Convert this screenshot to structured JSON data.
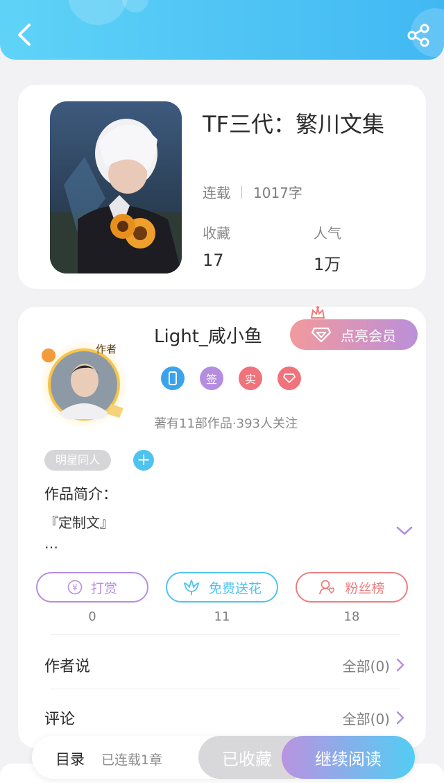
{
  "header": {
    "back_icon": "chevron-left-icon",
    "share_icon": "share-icon",
    "color": "#41b8f3"
  },
  "book": {
    "title": "TF三代：繁川文集",
    "status": "连载",
    "word_count": "1017字",
    "stats": [
      {
        "label": "收藏",
        "value": "17"
      },
      {
        "label": "人气",
        "value": "1万"
      }
    ]
  },
  "author": {
    "name": "Light_咸小鱼",
    "avatar_badge": "作者",
    "vip_button": "点亮会员",
    "badges": [
      {
        "icon": "phone-icon",
        "text": "",
        "color": "#3aa3ea"
      },
      {
        "icon": "sign-icon",
        "text": "签",
        "color": "#b58de0"
      },
      {
        "icon": "verified-icon",
        "text": "实",
        "color": "#f0727a"
      },
      {
        "icon": "diamond-icon",
        "text": "",
        "color": "#f0727a"
      }
    ],
    "meta": "著有11部作品·393人关注"
  },
  "tags": [
    "明星同人"
  ],
  "intro": {
    "label": "作品简介：",
    "line1": "『定制文』",
    "line2": "…"
  },
  "actions": [
    {
      "label": "打赏",
      "icon": "yen-icon",
      "count": "0",
      "color": "#b58de0"
    },
    {
      "label": "免费送花",
      "icon": "flower-icon",
      "count": "11",
      "color": "#4fc3ef"
    },
    {
      "label": "粉丝榜",
      "icon": "fan-icon",
      "count": "18",
      "color": "#ec7d7d"
    }
  ],
  "sections": [
    {
      "title": "作者说",
      "link": "全部(0)"
    },
    {
      "title": "评论",
      "link": "全部(0)"
    }
  ],
  "bottom_bar": {
    "toc": "目录",
    "toc_status": "已连载1章",
    "collected": "已收藏",
    "continue": "继续阅读"
  }
}
